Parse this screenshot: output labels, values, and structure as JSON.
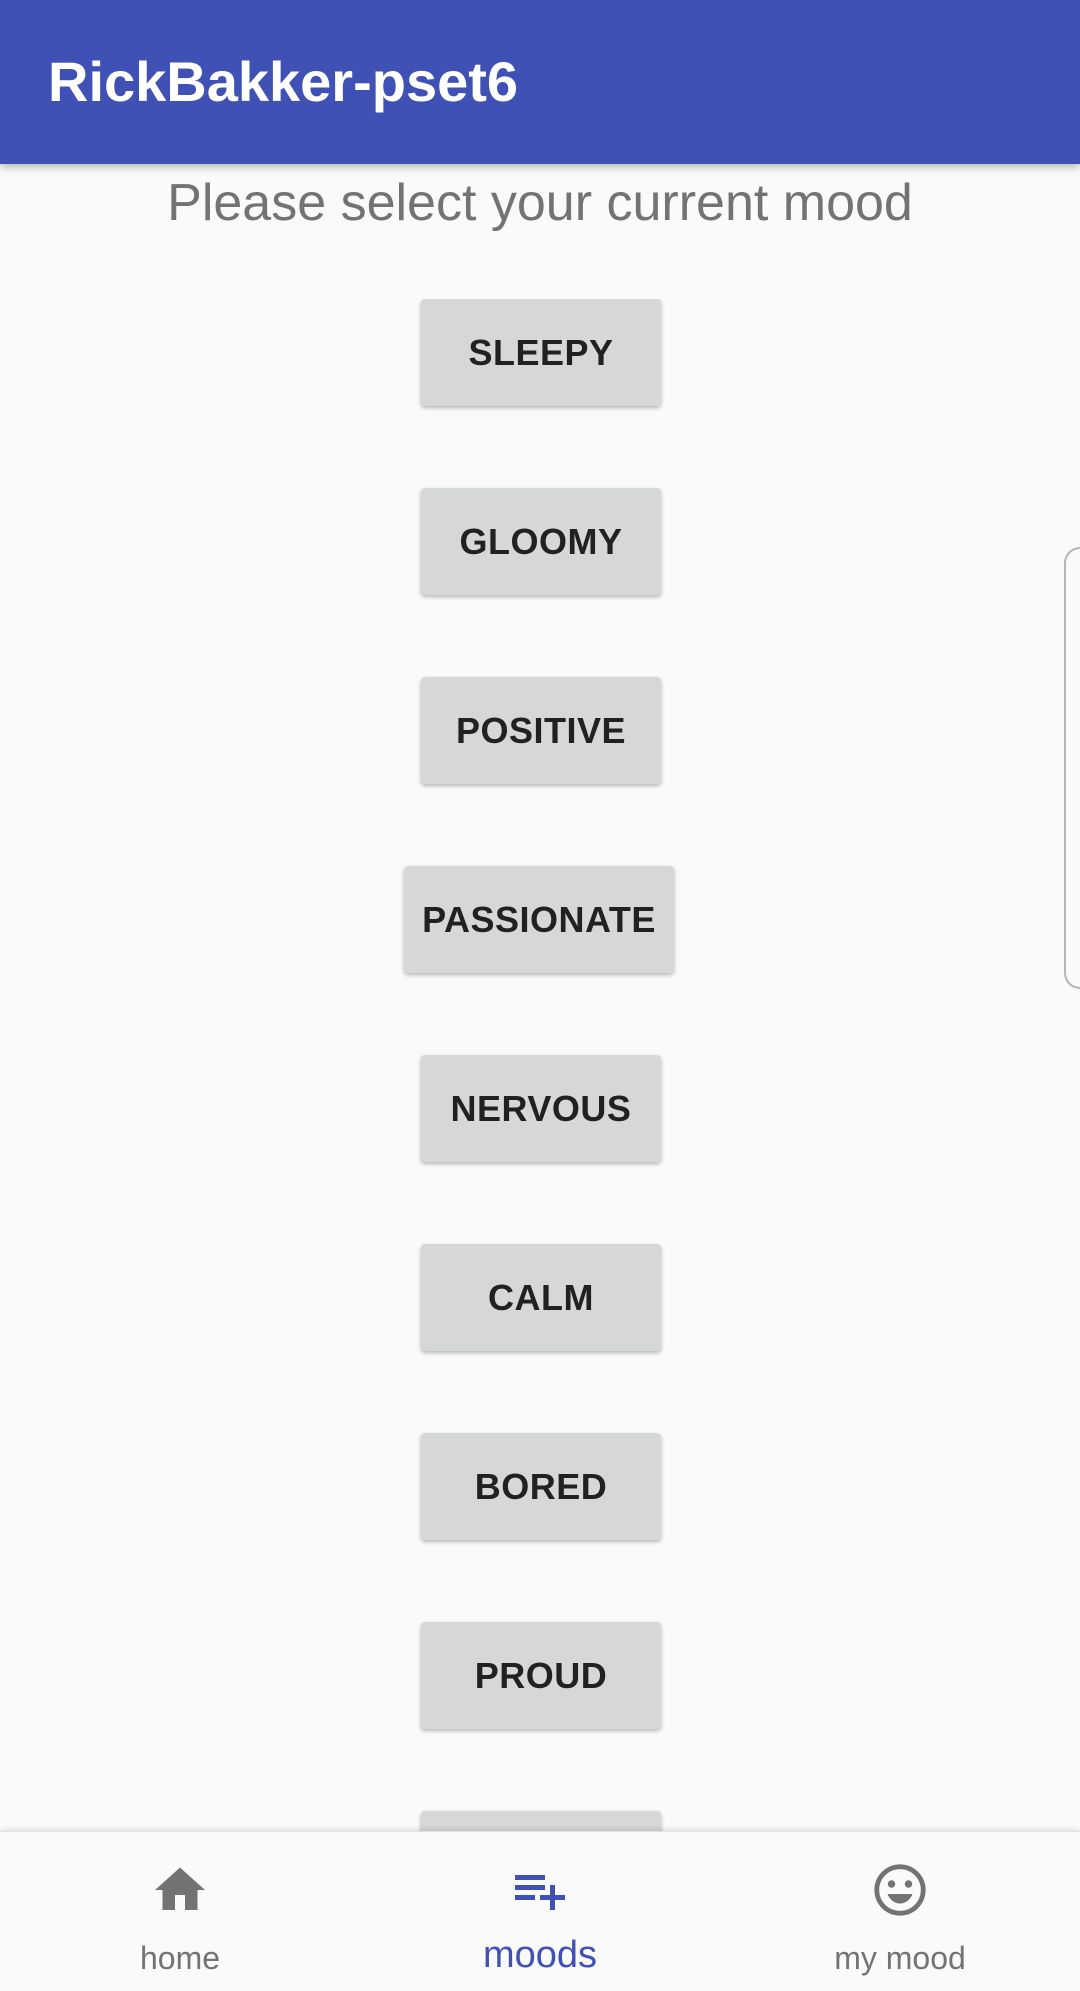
{
  "app": {
    "title": "RickBakker-pset6"
  },
  "colors": {
    "primary": "#3f51b5",
    "button_bg": "#d6d7d7",
    "inactive": "#737373",
    "background": "#fafafa"
  },
  "main": {
    "prompt": "Please select your current mood",
    "moods": [
      {
        "label": "SLEEPY"
      },
      {
        "label": "GLOOMY"
      },
      {
        "label": "POSITIVE"
      },
      {
        "label": "PASSIONATE"
      },
      {
        "label": "NERVOUS"
      },
      {
        "label": "CALM"
      },
      {
        "label": "BORED"
      },
      {
        "label": "PROUD"
      },
      {
        "label": ""
      }
    ]
  },
  "bottom_nav": {
    "items": [
      {
        "label": "home",
        "icon": "home-icon",
        "active": false
      },
      {
        "label": "moods",
        "icon": "playlist-add-icon",
        "active": true
      },
      {
        "label": "my mood",
        "icon": "smiley-icon",
        "active": false
      }
    ]
  }
}
